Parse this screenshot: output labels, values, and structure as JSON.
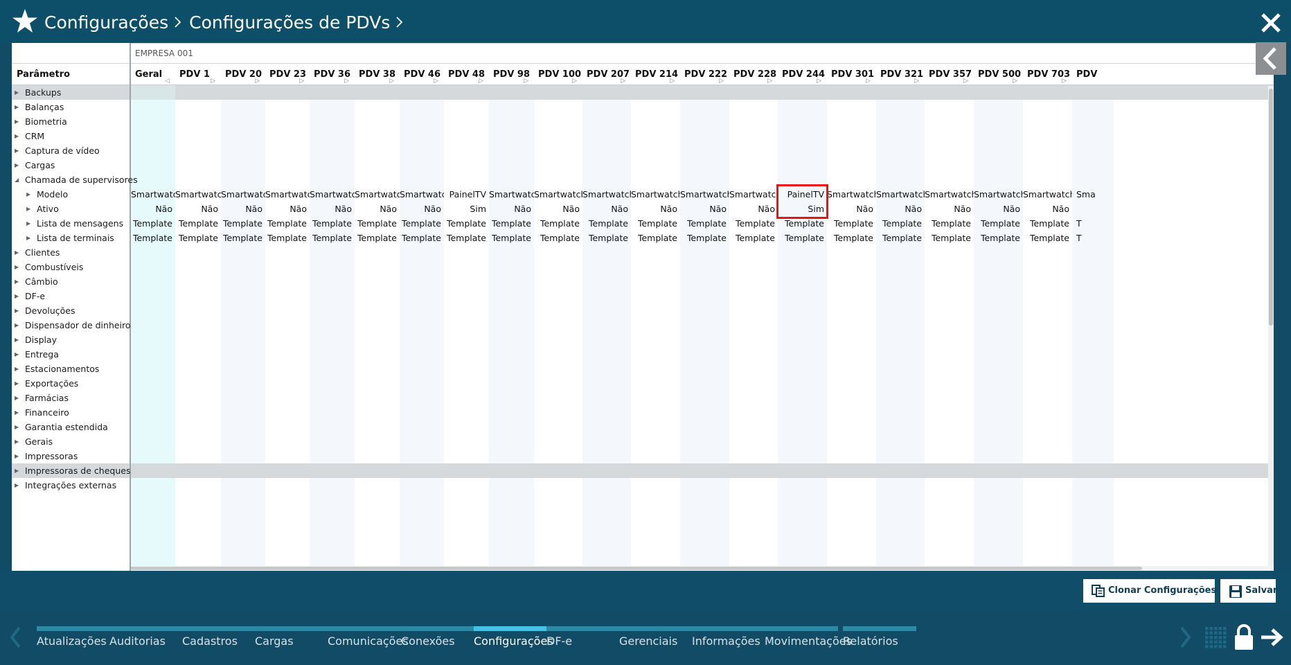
{
  "header": {
    "breadcrumb": [
      "Configurações",
      "Configurações de PDVs"
    ],
    "star_icon": "star-icon",
    "close_icon": "close-icon"
  },
  "grid": {
    "company_label": "EMPRESA 001",
    "param_header": "Parâmetro",
    "columns": [
      "Geral",
      "PDV 1",
      "PDV 20",
      "PDV 23",
      "PDV 36",
      "PDV 38",
      "PDV 46",
      "PDV 48",
      "PDV 98",
      "PDV 100",
      "PDV 207",
      "PDV 214",
      "PDV 222",
      "PDV 228",
      "PDV 244",
      "PDV 301",
      "PDV 321",
      "PDV 357",
      "PDV 500",
      "PDV 703",
      "PDV"
    ],
    "tree": [
      {
        "label": "Backups",
        "level": 0,
        "expanded": false
      },
      {
        "label": "Balanças",
        "level": 0,
        "expanded": false
      },
      {
        "label": "Biometria",
        "level": 0,
        "expanded": false
      },
      {
        "label": "CRM",
        "level": 0,
        "expanded": false
      },
      {
        "label": "Captura de vídeo",
        "level": 0,
        "expanded": false
      },
      {
        "label": "Cargas",
        "level": 0,
        "expanded": false
      },
      {
        "label": "Chamada de supervisores",
        "level": 0,
        "expanded": true
      },
      {
        "label": "Modelo",
        "level": 1,
        "expanded": false
      },
      {
        "label": "Ativo",
        "level": 1,
        "expanded": false
      },
      {
        "label": "Lista de mensagens",
        "level": 1,
        "expanded": false
      },
      {
        "label": "Lista de terminais",
        "level": 1,
        "expanded": false
      },
      {
        "label": "Clientes",
        "level": 0,
        "expanded": false
      },
      {
        "label": "Combustíveis",
        "level": 0,
        "expanded": false
      },
      {
        "label": "Câmbio",
        "level": 0,
        "expanded": false
      },
      {
        "label": "DF-e",
        "level": 0,
        "expanded": false
      },
      {
        "label": "Devoluções",
        "level": 0,
        "expanded": false
      },
      {
        "label": "Dispensador de dinheiro",
        "level": 0,
        "expanded": false
      },
      {
        "label": "Display",
        "level": 0,
        "expanded": false
      },
      {
        "label": "Entrega",
        "level": 0,
        "expanded": false
      },
      {
        "label": "Estacionamentos",
        "level": 0,
        "expanded": false
      },
      {
        "label": "Exportações",
        "level": 0,
        "expanded": false
      },
      {
        "label": "Farmácias",
        "level": 0,
        "expanded": false
      },
      {
        "label": "Financeiro",
        "level": 0,
        "expanded": false
      },
      {
        "label": "Garantia estendida",
        "level": 0,
        "expanded": false
      },
      {
        "label": "Gerais",
        "level": 0,
        "expanded": false
      },
      {
        "label": "Impressoras",
        "level": 0,
        "expanded": false
      },
      {
        "label": "Impressoras de cheques",
        "level": 0,
        "expanded": false
      },
      {
        "label": "Integrações externas",
        "level": 0,
        "expanded": false
      }
    ],
    "rows": {
      "modelo": [
        "Smartwatch",
        "Smartwatch",
        "Smartwatch",
        "Smartwatch",
        "Smartwatch",
        "Smartwatch",
        "Smartwatch",
        "PainelTV",
        "Smartwatch",
        "Smartwatch",
        "Smartwatch",
        "Smartwatch",
        "Smartwatch",
        "Smartwatch",
        "PainelTV",
        "Smartwatch",
        "Smartwatch",
        "Smartwatch",
        "Smartwatch",
        "Smartwatch",
        "Sma"
      ],
      "ativo": [
        "Não",
        "Não",
        "Não",
        "Não",
        "Não",
        "Não",
        "Não",
        "Sim",
        "Não",
        "Não",
        "Não",
        "Não",
        "Não",
        "Não",
        "Sim",
        "Não",
        "Não",
        "Não",
        "Não",
        "Não",
        ""
      ],
      "mensagens": [
        "Template",
        "Template",
        "Template",
        "Template",
        "Template",
        "Template",
        "Template",
        "Template",
        "Template",
        "Template",
        "Template",
        "Template",
        "Template",
        "Template",
        "Template",
        "Template",
        "Template",
        "Template",
        "Template",
        "Template",
        "T"
      ],
      "terminais": [
        "Template",
        "Template",
        "Template",
        "Template",
        "Template",
        "Template",
        "Template",
        "Template",
        "Template",
        "Template",
        "Template",
        "Template",
        "Template",
        "Template",
        "Template",
        "Template",
        "Template",
        "Template",
        "Template",
        "Template",
        "T"
      ]
    },
    "highlighted_column": "PDV 244"
  },
  "actions": {
    "clone_label": "Clonar Configurações",
    "save_label": "Salvar"
  },
  "bottom_nav": {
    "items": [
      "Atualizações",
      "Auditorias",
      "Cadastros",
      "Cargas",
      "Comunicações",
      "Conexões",
      "Configurações",
      "DF-e",
      "Gerenciais",
      "Informações",
      "Movimentações",
      "Relatórios"
    ],
    "active": "Configurações"
  },
  "colors": {
    "header_bg": "#0d4f69",
    "nav_bar": "#2e8aa4",
    "nav_bar_active": "#47c2e4",
    "highlight": "#e11111",
    "geral_col": "#e6fafb"
  }
}
